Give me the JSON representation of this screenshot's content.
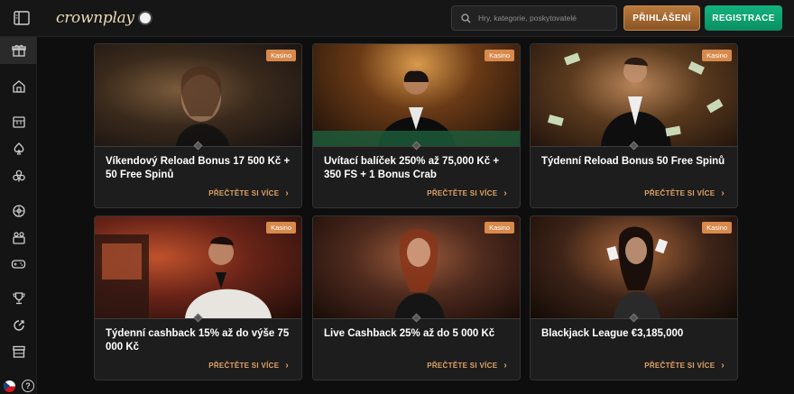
{
  "header": {
    "logo_text": "crownplay",
    "search_placeholder": "Hry, kategorie, poskytovatelé",
    "login_label": "PŘIHLÁŠENÍ",
    "register_label": "REGISTRACE"
  },
  "sidebar": {
    "items": [
      {
        "icon": "gift-icon",
        "active": true
      },
      {
        "icon": "home-icon",
        "active": false
      },
      {
        "icon": "slot-machine-icon",
        "active": false
      },
      {
        "icon": "spade-icon",
        "active": false
      },
      {
        "icon": "poker-chip-icon",
        "active": false
      },
      {
        "icon": "roulette-icon",
        "active": false
      },
      {
        "icon": "live-dealer-icon",
        "active": false
      },
      {
        "icon": "gamepad-icon",
        "active": false
      },
      {
        "icon": "trophy-icon",
        "active": false
      },
      {
        "icon": "promo-icon",
        "active": false
      },
      {
        "icon": "store-icon",
        "active": false
      }
    ],
    "language_flag": "czech-flag-icon",
    "help_label": "?"
  },
  "promotions": [
    {
      "badge": "Kasino",
      "title": "Víkendový Reload Bonus 17 500 Kč + 50 Free Spinů",
      "cta": "PŘEČTĚTE SI VÍCE",
      "theme": "#3a2a1c"
    },
    {
      "badge": "Kasino",
      "title": "Uvítací balíček 250% až 75,000 Kč + 350 FS + 1 Bonus Crab",
      "cta": "PŘEČTĚTE SI VÍCE",
      "theme": "#4a2c14"
    },
    {
      "badge": "Kasino",
      "title": "Týdenní Reload Bonus 50 Free Spinů",
      "cta": "PŘEČTĚTE SI VÍCE",
      "theme": "#5a3a1e"
    },
    {
      "badge": "Kasino",
      "title": "Týdenní cashback 15% až do výše 75 000 Kč",
      "cta": "PŘEČTĚTE SI VÍCE",
      "theme": "#6a2418"
    },
    {
      "badge": "Kasino",
      "title": "Live Cashback 25% až do 5 000 Kč",
      "cta": "PŘEČTĚTE SI VÍCE",
      "theme": "#4e2a1e"
    },
    {
      "badge": "Kasino",
      "title": "Blackjack League €3,185,000",
      "cta": "PŘEČTĚTE SI VÍCE",
      "theme": "#3e2418"
    }
  ],
  "colors": {
    "accent_gold": "#e0a467",
    "badge": "#d78a4c",
    "register_green": "#12b37e",
    "login_bronze": "#b97a3c"
  }
}
